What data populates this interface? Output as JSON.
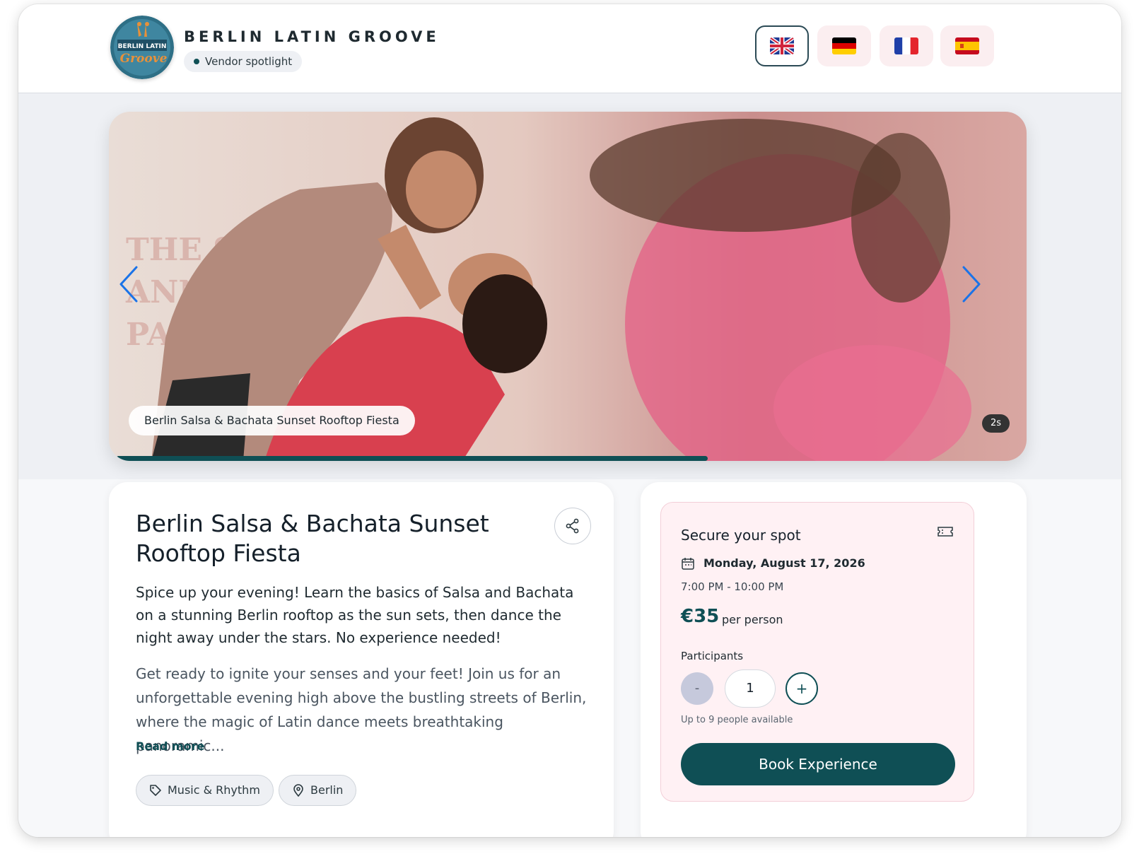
{
  "header": {
    "brand_title": "BERLIN LATIN GROOVE",
    "badge_label": "Vendor spotlight",
    "logo_text_top": "BERLIN LATIN",
    "logo_text_script": "Groove",
    "languages": [
      {
        "code": "en",
        "flag": "uk-flag-icon",
        "active": true
      },
      {
        "code": "de",
        "flag": "germany-flag-icon",
        "active": false
      },
      {
        "code": "fr",
        "flag": "france-flag-icon",
        "active": false
      },
      {
        "code": "es",
        "flag": "spain-flag-icon",
        "active": false
      }
    ]
  },
  "carousel": {
    "caption": "Berlin Salsa & Bachata Sunset Rooftop Fiesta",
    "timer": "2s",
    "progress": 0.645,
    "prev_icon": "chevron-left-icon",
    "next_icon": "chevron-right-icon"
  },
  "event": {
    "title": "Berlin Salsa & Bachata Sunset Rooftop Fiesta",
    "lead": "Spice up your evening! Learn the basics of Salsa and Bachata on a stunning Berlin rooftop as the sun sets, then dance the night away under the stars. No experience needed!",
    "description": "Get ready to ignite your senses and your feet! Join us for an unforgettable evening high above the bustling streets of Berlin, where the magic of Latin dance meets breathtaking panoramic...",
    "read_more": "Read more",
    "tags": [
      {
        "label": "Music & Rhythm",
        "icon": "tag-icon"
      },
      {
        "label": "Berlin",
        "icon": "location-pin-icon"
      }
    ]
  },
  "booking": {
    "title": "Secure your spot",
    "date": "Monday, August 17, 2026",
    "time": "7:00 PM - 10:00 PM",
    "price": "€35",
    "price_unit": "per person",
    "participants_label": "Participants",
    "minus": "-",
    "quantity": "1",
    "plus": "+",
    "availability": "Up to 9 people available",
    "book_label": "Book Experience"
  },
  "colors": {
    "accent": "#0f4f55",
    "panel_pink": "#fff1f4",
    "chevron_blue": "#1a73e8"
  }
}
